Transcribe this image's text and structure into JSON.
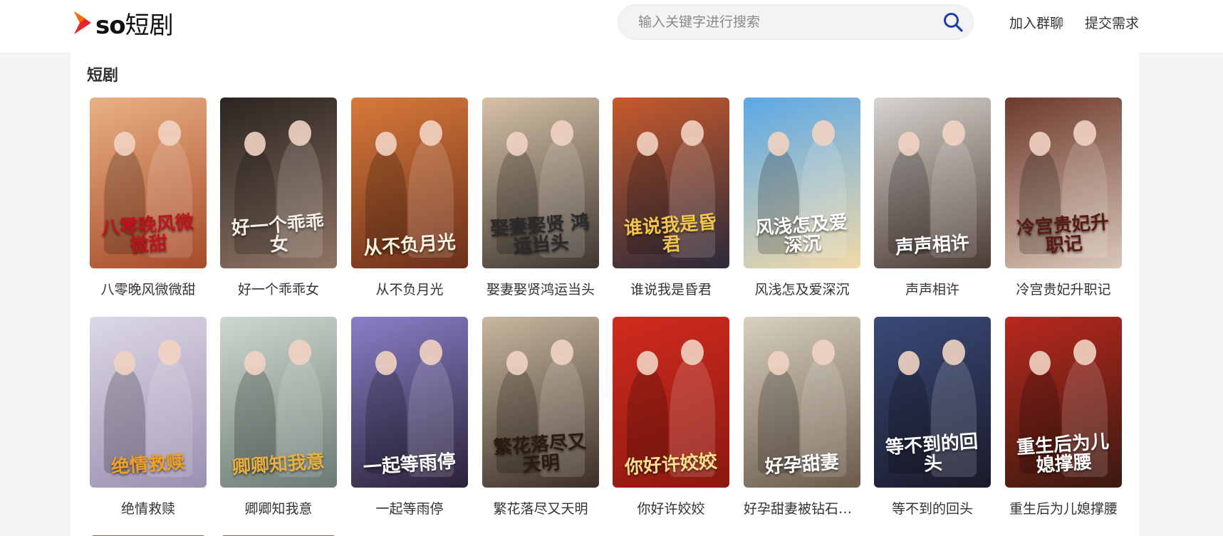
{
  "header": {
    "logo_text": "so",
    "logo_cn": "短剧",
    "search_placeholder": "输入关键字进行搜索",
    "nav": [
      "加入群聊",
      "提交需求"
    ]
  },
  "section": {
    "title": "短剧"
  },
  "colors": {
    "logo_orange": "#ff6a00",
    "logo_red": "#e8242b",
    "search_icon": "#1e3fa8"
  },
  "dramas": [
    {
      "title": "八零晚风微微甜",
      "poster_text": "八零晚风微微甜",
      "bg": [
        "#e9b183",
        "#a64a2a"
      ],
      "accent": "#c0141b"
    },
    {
      "title": "好一个乖乖女",
      "poster_text": "好一个乖乖女",
      "bg": [
        "#2b2420",
        "#8e7565"
      ],
      "accent": "#f4efe6"
    },
    {
      "title": "从不负月光",
      "poster_text": "从不负月光",
      "bg": [
        "#d87a3a",
        "#6b2f1a"
      ],
      "accent": "#fff4e0"
    },
    {
      "title": "娶妻娶贤鸿运当头",
      "poster_text": "娶妻娶贤 鸿运当头",
      "bg": [
        "#d7c2a8",
        "#3e3630"
      ],
      "accent": "#2a2a2a"
    },
    {
      "title": "谁说我是昏君",
      "poster_text": "谁说我是昏君",
      "bg": [
        "#c85a2c",
        "#2a2a3a"
      ],
      "accent": "#f2c54a"
    },
    {
      "title": "风浅怎及爱深沉",
      "poster_text": "风浅怎及爱深沉",
      "bg": [
        "#5aa8e6",
        "#f2d9a8"
      ],
      "accent": "#ffffff"
    },
    {
      "title": "声声相许",
      "poster_text": "声声相许",
      "bg": [
        "#d8d4d0",
        "#4a3a32"
      ],
      "accent": "#ffffff"
    },
    {
      "title": "冷宫贵妃升职记",
      "poster_text": "冷宫贵妃升职记",
      "bg": [
        "#6e3a2c",
        "#d9c7b8"
      ],
      "accent": "#5a1a12"
    },
    {
      "title": "绝情救赎",
      "poster_text": "绝情救赎",
      "bg": [
        "#dcd8e6",
        "#9b8fb0"
      ],
      "accent": "#f0a020"
    },
    {
      "title": "卿卿知我意",
      "poster_text": "卿卿知我意",
      "bg": [
        "#cfd8d0",
        "#6a7a72"
      ],
      "accent": "#e8b040"
    },
    {
      "title": "一起等雨停",
      "poster_text": "一起等雨停",
      "bg": [
        "#8a7fc8",
        "#2a2238"
      ],
      "accent": "#ffffff"
    },
    {
      "title": "繁花落尽又天明",
      "poster_text": "繁花落尽又天明",
      "bg": [
        "#c8b8a0",
        "#3a2e26"
      ],
      "accent": "#2a1a10"
    },
    {
      "title": "你好许姣姣",
      "poster_text": "你好许姣姣",
      "bg": [
        "#d22b1e",
        "#8a1810"
      ],
      "accent": "#ffe08a"
    },
    {
      "title": "好孕甜妻被钻石老公宠上天",
      "poster_text": "好孕甜妻",
      "bg": [
        "#d8d0c0",
        "#6a5a4a"
      ],
      "accent": "#ffffff"
    },
    {
      "title": "等不到的回头",
      "poster_text": "等不到的回头",
      "bg": [
        "#3a4a78",
        "#1a1a2a"
      ],
      "accent": "#ffffff"
    },
    {
      "title": "重生后为儿媳撑腰",
      "poster_text": "重生后为儿媳撑腰",
      "bg": [
        "#b8281e",
        "#3a1a10"
      ],
      "accent": "#ffffff"
    }
  ]
}
